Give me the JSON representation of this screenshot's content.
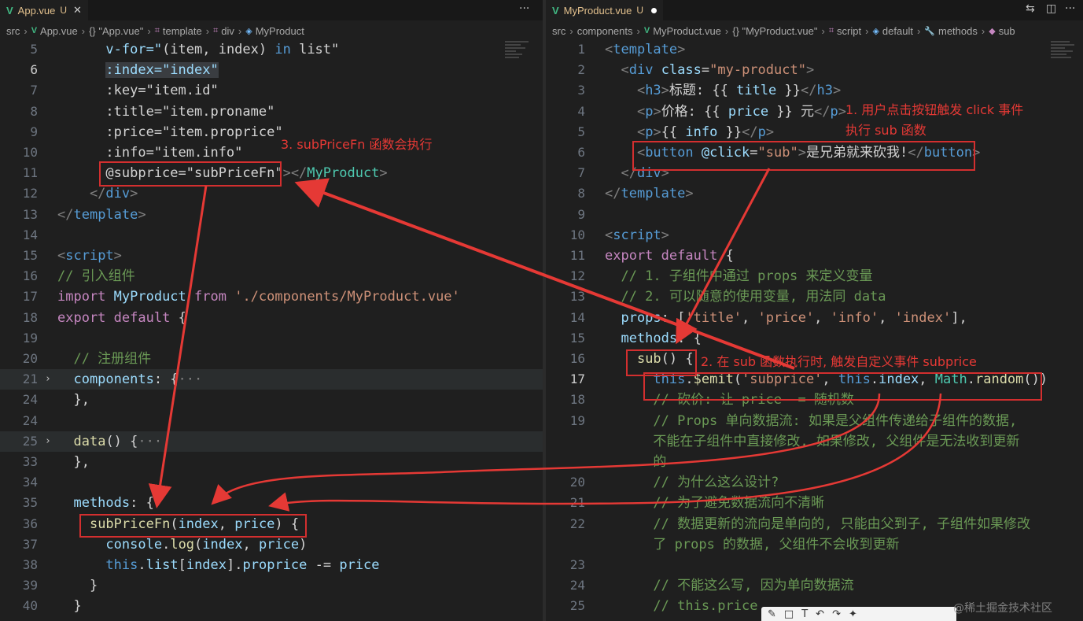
{
  "left": {
    "tab": {
      "label": "App.vue",
      "status": "U"
    },
    "breadcrumb": [
      "src",
      "App.vue",
      "{} \"App.vue\"",
      "template",
      "div",
      "MyProduct"
    ],
    "lines": [
      {
        "n": "5",
        "code": [
          [
            "      v-for=\"",
            "t-attr"
          ],
          [
            "(item, index) ",
            "t-txt"
          ],
          [
            "in",
            "t-kw2"
          ],
          [
            " list\"",
            "t-txt"
          ]
        ]
      },
      {
        "n": "6",
        "code": [
          [
            "      ",
            "t-txt"
          ],
          [
            ":index=\"index\"",
            "t-attr"
          ]
        ]
      },
      {
        "n": "7",
        "code": [
          [
            "      :key=\"item.id\"",
            "t-txt"
          ]
        ]
      },
      {
        "n": "8",
        "code": [
          [
            "      :title=\"item.proname\"",
            "t-txt"
          ]
        ]
      },
      {
        "n": "9",
        "code": [
          [
            "      :price=\"item.proprice\"",
            "t-txt"
          ]
        ]
      },
      {
        "n": "10",
        "code": [
          [
            "      :info=\"item.info\"",
            "t-txt"
          ]
        ]
      },
      {
        "n": "11",
        "code": [
          [
            "      @subprice=\"subPriceFn\"",
            "t-txt"
          ],
          [
            "></",
            "t-br"
          ],
          [
            "MyProduct",
            "t-cls"
          ],
          [
            ">",
            "t-br"
          ]
        ]
      },
      {
        "n": "12",
        "code": [
          [
            "    </",
            "t-br"
          ],
          [
            "div",
            "t-tag"
          ],
          [
            ">",
            "t-br"
          ]
        ]
      },
      {
        "n": "13",
        "code": [
          [
            "</",
            "t-br"
          ],
          [
            "template",
            "t-tag"
          ],
          [
            ">",
            "t-br"
          ]
        ]
      },
      {
        "n": "14",
        "code": []
      },
      {
        "n": "15",
        "code": [
          [
            "<",
            "t-br"
          ],
          [
            "script",
            "t-tag"
          ],
          [
            ">",
            "t-br"
          ]
        ]
      },
      {
        "n": "16",
        "code": [
          [
            "// 引入组件",
            "t-cm"
          ]
        ]
      },
      {
        "n": "17",
        "code": [
          [
            "import",
            "t-kw"
          ],
          [
            " MyProduct ",
            "t-var"
          ],
          [
            "from",
            "t-kw"
          ],
          [
            " './components/MyProduct.vue'",
            "t-str"
          ]
        ]
      },
      {
        "n": "18",
        "code": [
          [
            "export",
            "t-kw"
          ],
          [
            " ",
            "t-txt"
          ],
          [
            "default",
            "t-kw"
          ],
          [
            " {",
            "t-txt"
          ]
        ]
      },
      {
        "n": "19",
        "code": []
      },
      {
        "n": "20",
        "code": [
          [
            "  // 注册组件",
            "t-cm"
          ]
        ]
      },
      {
        "n": "21",
        "code": [
          [
            "  components",
            "t-var"
          ],
          [
            ": {",
            "t-txt"
          ],
          [
            "···",
            "t-br"
          ]
        ]
      },
      {
        "n": "24",
        "code": [
          [
            "  },",
            "t-txt"
          ]
        ]
      },
      {
        "n": "24",
        "code": []
      },
      {
        "n": "25",
        "code": [
          [
            "  ",
            "t-txt"
          ],
          [
            "data",
            "t-fn"
          ],
          [
            "() {",
            "t-txt"
          ],
          [
            "···",
            "t-br"
          ]
        ]
      },
      {
        "n": "33",
        "code": [
          [
            "  },",
            "t-txt"
          ]
        ]
      },
      {
        "n": "34",
        "code": []
      },
      {
        "n": "35",
        "code": [
          [
            "  methods",
            "t-var"
          ],
          [
            ": {",
            "t-txt"
          ]
        ]
      },
      {
        "n": "36",
        "code": [
          [
            "    ",
            "t-txt"
          ],
          [
            "subPriceFn",
            "t-fn"
          ],
          [
            "(",
            "t-txt"
          ],
          [
            "index",
            "t-var"
          ],
          [
            ", ",
            "t-txt"
          ],
          [
            "price",
            "t-var"
          ],
          [
            ") {",
            "t-txt"
          ]
        ]
      },
      {
        "n": "37",
        "code": [
          [
            "      ",
            "t-txt"
          ],
          [
            "console",
            "t-var"
          ],
          [
            ".",
            "t-txt"
          ],
          [
            "log",
            "t-fn"
          ],
          [
            "(",
            "t-txt"
          ],
          [
            "index",
            "t-var"
          ],
          [
            ", ",
            "t-txt"
          ],
          [
            "price",
            "t-var"
          ],
          [
            ")",
            "t-txt"
          ]
        ]
      },
      {
        "n": "38",
        "code": [
          [
            "      ",
            "t-txt"
          ],
          [
            "this",
            "t-kw2"
          ],
          [
            ".",
            "t-txt"
          ],
          [
            "list",
            "t-var"
          ],
          [
            "[",
            "t-txt"
          ],
          [
            "index",
            "t-var"
          ],
          [
            "].",
            "t-txt"
          ],
          [
            "proprice",
            "t-var"
          ],
          [
            " -= ",
            "t-txt"
          ],
          [
            "price",
            "t-var"
          ]
        ]
      },
      {
        "n": "39",
        "code": [
          [
            "    }",
            "t-txt"
          ]
        ]
      },
      {
        "n": "40",
        "code": [
          [
            "  }",
            "t-txt"
          ]
        ]
      }
    ],
    "annotation_3": "3. subPriceFn 函数会执行"
  },
  "right": {
    "tab": {
      "label": "MyProduct.vue",
      "status": "U"
    },
    "breadcrumb": [
      "src",
      "components",
      "MyProduct.vue",
      "{} \"MyProduct.vue\"",
      "script",
      "default",
      "methods",
      "sub"
    ],
    "lines": [
      {
        "n": "1",
        "code": [
          [
            "<",
            "t-br"
          ],
          [
            "template",
            "t-tag"
          ],
          [
            ">",
            "t-br"
          ]
        ]
      },
      {
        "n": "2",
        "code": [
          [
            "  <",
            "t-br"
          ],
          [
            "div",
            "t-tag"
          ],
          [
            " ",
            "t-txt"
          ],
          [
            "class",
            "t-attr"
          ],
          [
            "=",
            "t-txt"
          ],
          [
            "\"my-product\"",
            "t-str"
          ],
          [
            ">",
            "t-br"
          ]
        ]
      },
      {
        "n": "3",
        "code": [
          [
            "    <",
            "t-br"
          ],
          [
            "h3",
            "t-tag"
          ],
          [
            ">",
            "t-br"
          ],
          [
            "标题: {{ ",
            "t-txt"
          ],
          [
            "title",
            "t-var"
          ],
          [
            " }}",
            "t-txt"
          ],
          [
            "</",
            "t-br"
          ],
          [
            "h3",
            "t-tag"
          ],
          [
            ">",
            "t-br"
          ]
        ]
      },
      {
        "n": "4",
        "code": [
          [
            "    <",
            "t-br"
          ],
          [
            "p",
            "t-tag"
          ],
          [
            ">",
            "t-br"
          ],
          [
            "价格: {{ ",
            "t-txt"
          ],
          [
            "price",
            "t-var"
          ],
          [
            " }} 元",
            "t-txt"
          ],
          [
            "</",
            "t-br"
          ],
          [
            "p",
            "t-tag"
          ],
          [
            ">",
            "t-br"
          ]
        ]
      },
      {
        "n": "5",
        "code": [
          [
            "    <",
            "t-br"
          ],
          [
            "p",
            "t-tag"
          ],
          [
            ">",
            "t-br"
          ],
          [
            "{{ ",
            "t-txt"
          ],
          [
            "info",
            "t-var"
          ],
          [
            " }}",
            "t-txt"
          ],
          [
            "</",
            "t-br"
          ],
          [
            "p",
            "t-tag"
          ],
          [
            ">",
            "t-br"
          ]
        ]
      },
      {
        "n": "6",
        "code": [
          [
            "    <",
            "t-br"
          ],
          [
            "button",
            "t-tag"
          ],
          [
            " ",
            "t-txt"
          ],
          [
            "@click",
            "t-attr"
          ],
          [
            "=",
            "t-txt"
          ],
          [
            "\"sub\"",
            "t-str"
          ],
          [
            ">",
            "t-br"
          ],
          [
            "是兄弟就来砍我!",
            "t-txt"
          ],
          [
            "</",
            "t-br"
          ],
          [
            "button",
            "t-tag"
          ],
          [
            ">",
            "t-br"
          ]
        ]
      },
      {
        "n": "7",
        "code": [
          [
            "  </",
            "t-br"
          ],
          [
            "div",
            "t-tag"
          ],
          [
            ">",
            "t-br"
          ]
        ]
      },
      {
        "n": "8",
        "code": [
          [
            "</",
            "t-br"
          ],
          [
            "template",
            "t-tag"
          ],
          [
            ">",
            "t-br"
          ]
        ]
      },
      {
        "n": "9",
        "code": []
      },
      {
        "n": "10",
        "code": [
          [
            "<",
            "t-br"
          ],
          [
            "script",
            "t-tag"
          ],
          [
            ">",
            "t-br"
          ]
        ]
      },
      {
        "n": "11",
        "code": [
          [
            "export",
            "t-kw"
          ],
          [
            " ",
            "t-txt"
          ],
          [
            "default",
            "t-kw"
          ],
          [
            " {",
            "t-txt"
          ]
        ]
      },
      {
        "n": "12",
        "code": [
          [
            "  // 1. 子组件中通过 props 来定义变量",
            "t-cm"
          ]
        ]
      },
      {
        "n": "13",
        "code": [
          [
            "  // 2. 可以随意的使用变量, 用法同 data",
            "t-cm"
          ]
        ]
      },
      {
        "n": "14",
        "code": [
          [
            "  props",
            "t-var"
          ],
          [
            ": [",
            "t-txt"
          ],
          [
            "'title'",
            "t-str"
          ],
          [
            ", ",
            "t-txt"
          ],
          [
            "'price'",
            "t-str"
          ],
          [
            ", ",
            "t-txt"
          ],
          [
            "'info'",
            "t-str"
          ],
          [
            ", ",
            "t-txt"
          ],
          [
            "'index'",
            "t-str"
          ],
          [
            "],",
            "t-txt"
          ]
        ]
      },
      {
        "n": "15",
        "code": [
          [
            "  methods",
            "t-var"
          ],
          [
            ": {",
            "t-txt"
          ]
        ]
      },
      {
        "n": "16",
        "code": [
          [
            "    ",
            "t-txt"
          ],
          [
            "sub",
            "t-fn"
          ],
          [
            "() {",
            "t-txt"
          ]
        ]
      },
      {
        "n": "17",
        "code": [
          [
            "      ",
            "t-txt"
          ],
          [
            "this",
            "t-kw2"
          ],
          [
            ".",
            "t-txt"
          ],
          [
            "$emit",
            "t-fn"
          ],
          [
            "(",
            "t-txt"
          ],
          [
            "'subprice'",
            "t-str"
          ],
          [
            ", ",
            "t-txt"
          ],
          [
            "this",
            "t-kw2"
          ],
          [
            ".",
            "t-txt"
          ],
          [
            "index",
            "t-var"
          ],
          [
            ", ",
            "t-txt"
          ],
          [
            "Math",
            "t-cls"
          ],
          [
            ".",
            "t-txt"
          ],
          [
            "random",
            "t-fn"
          ],
          [
            "())",
            "t-txt"
          ]
        ]
      },
      {
        "n": "18",
        "code": [
          [
            "      // 砍价: 让 price -= 随机数",
            "t-cm"
          ]
        ]
      },
      {
        "n": "19",
        "code": [
          [
            "      // Props 单向数据流: 如果是父组件传递给子组件的数据,",
            "t-cm"
          ]
        ]
      },
      {
        "n": "",
        "code": [
          [
            "      不能在子组件中直接修改, 如果修改, 父组件是无法收到更新",
            "t-cm"
          ]
        ]
      },
      {
        "n": "",
        "code": [
          [
            "      的",
            "t-cm"
          ]
        ]
      },
      {
        "n": "20",
        "code": [
          [
            "      // 为什么这么设计?",
            "t-cm"
          ]
        ]
      },
      {
        "n": "21",
        "code": [
          [
            "      // 为了避免数据流向不清晰",
            "t-cm"
          ]
        ]
      },
      {
        "n": "22",
        "code": [
          [
            "      // 数据更新的流向是单向的, 只能由父到子, 子组件如果修改",
            "t-cm"
          ]
        ]
      },
      {
        "n": "",
        "code": [
          [
            "      了 props 的数据, 父组件不会收到更新",
            "t-cm"
          ]
        ]
      },
      {
        "n": "23",
        "code": []
      },
      {
        "n": "24",
        "code": [
          [
            "      // 不能这么写, 因为单向数据流",
            "t-cm"
          ]
        ]
      },
      {
        "n": "25",
        "code": [
          [
            "      // this.price",
            "t-cm"
          ]
        ]
      }
    ],
    "annotation_1a": "1. 用户点击按钮触发 click 事件",
    "annotation_1b": "执行 sub 函数",
    "annotation_2": "2. 在 sub 函数执行时, 触发自定义事件 subprice"
  },
  "watermark": "@稀土掘金技术社区",
  "icons": {
    "tab_more": "ellipsis-icon",
    "compare": "compare-changes-icon",
    "split": "split-editor-icon"
  },
  "colors": {
    "annotation": "#e53935",
    "vue": "#41b883"
  }
}
